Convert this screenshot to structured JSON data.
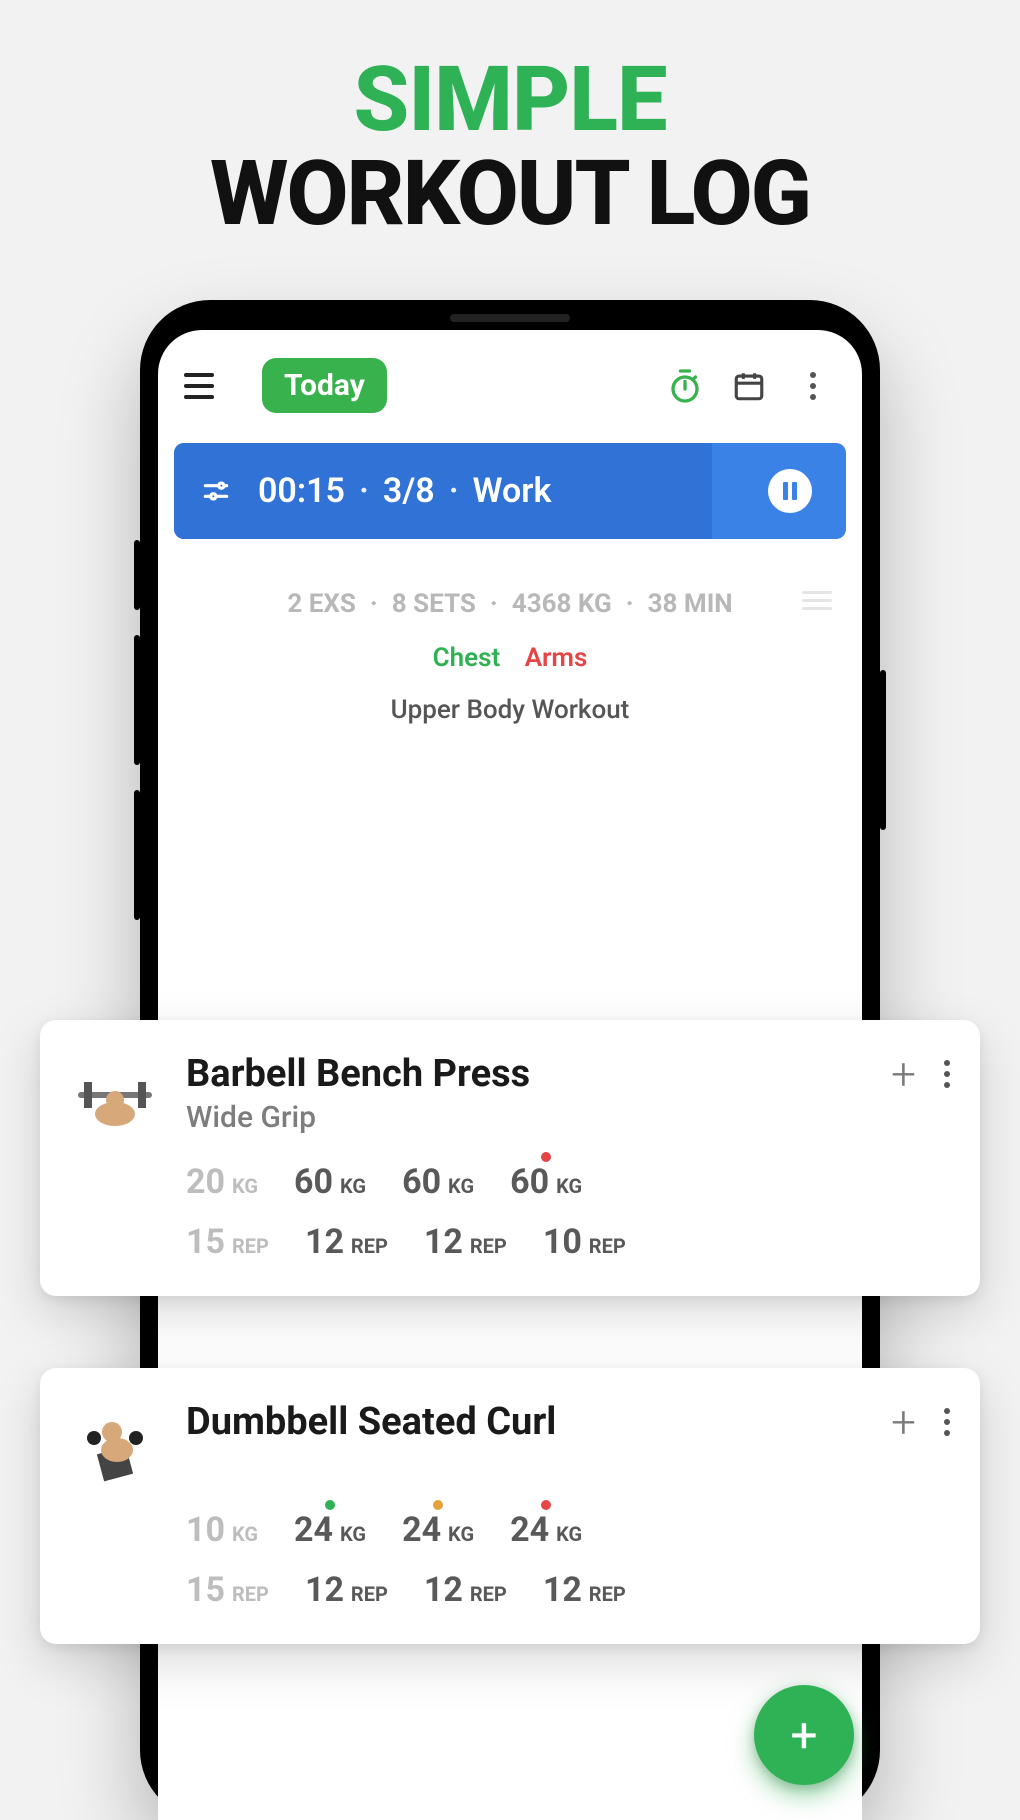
{
  "marketing": {
    "line1": "SIMPLE",
    "line2": "WORKOUT LOG"
  },
  "appbar": {
    "today_label": "Today"
  },
  "timer": {
    "time": "00:15",
    "round": "3/8",
    "phase": "Work"
  },
  "summary": {
    "exs": "2 EXS",
    "sets": "8 SETS",
    "volume": "4368 KG",
    "duration": "38 MIN"
  },
  "tags": {
    "chest": "Chest",
    "arms": "Arms"
  },
  "routine": {
    "name": "Upper Body Workout"
  },
  "exercises": [
    {
      "name": "Barbell Bench Press",
      "variant": "Wide Grip",
      "sets": [
        {
          "weight": "20",
          "wunit": "KG",
          "reps": "15",
          "runit": "REP",
          "tone": "light",
          "marker": null
        },
        {
          "weight": "60",
          "wunit": "KG",
          "reps": "12",
          "runit": "REP",
          "tone": "dark",
          "marker": null
        },
        {
          "weight": "60",
          "wunit": "KG",
          "reps": "12",
          "runit": "REP",
          "tone": "dark",
          "marker": null
        },
        {
          "weight": "60",
          "wunit": "KG",
          "reps": "10",
          "runit": "REP",
          "tone": "dark",
          "marker": "red"
        }
      ]
    },
    {
      "name": "Dumbbell Seated Curl",
      "variant": "",
      "sets": [
        {
          "weight": "10",
          "wunit": "KG",
          "reps": "15",
          "runit": "REP",
          "tone": "light",
          "marker": null
        },
        {
          "weight": "24",
          "wunit": "KG",
          "reps": "12",
          "runit": "REP",
          "tone": "dark",
          "marker": "green"
        },
        {
          "weight": "24",
          "wunit": "KG",
          "reps": "12",
          "runit": "REP",
          "tone": "dark",
          "marker": "amber"
        },
        {
          "weight": "24",
          "wunit": "KG",
          "reps": "12",
          "runit": "REP",
          "tone": "dark",
          "marker": "red"
        }
      ]
    }
  ],
  "colors": {
    "accent": "#2fb255",
    "timer": "#3b82e7"
  }
}
